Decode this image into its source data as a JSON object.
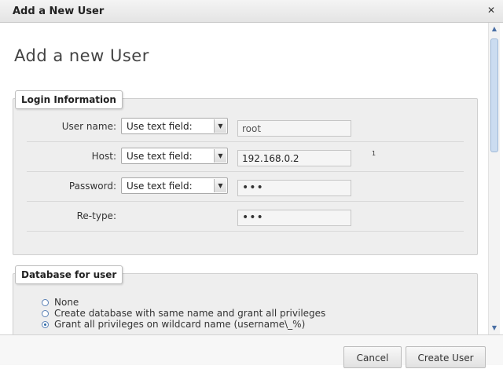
{
  "window": {
    "title": "Add a New User"
  },
  "heading": "Add a new User",
  "login": {
    "legend": "Login Information",
    "rows": [
      {
        "label": "User name:",
        "select": "Use text field:",
        "value": "root"
      },
      {
        "label": "Host:",
        "select": "Use text field:",
        "value": "192.168.0.2",
        "note": "1"
      },
      {
        "label": "Password:",
        "select": "Use text field:",
        "value": "•••"
      },
      {
        "label": "Re-type:",
        "value": "•••"
      }
    ]
  },
  "database": {
    "legend": "Database for user",
    "options": [
      {
        "label": "None",
        "checked": false
      },
      {
        "label": "Create database with same name and grant all privileges",
        "checked": false
      },
      {
        "label": "Grant all privileges on wildcard name (username\\_%)",
        "checked": true
      }
    ]
  },
  "footer": {
    "cancel_label": "Cancel",
    "create_label": "Create User"
  },
  "icons": {
    "close": "close-icon",
    "dropdown": "chevron-down-icon"
  }
}
